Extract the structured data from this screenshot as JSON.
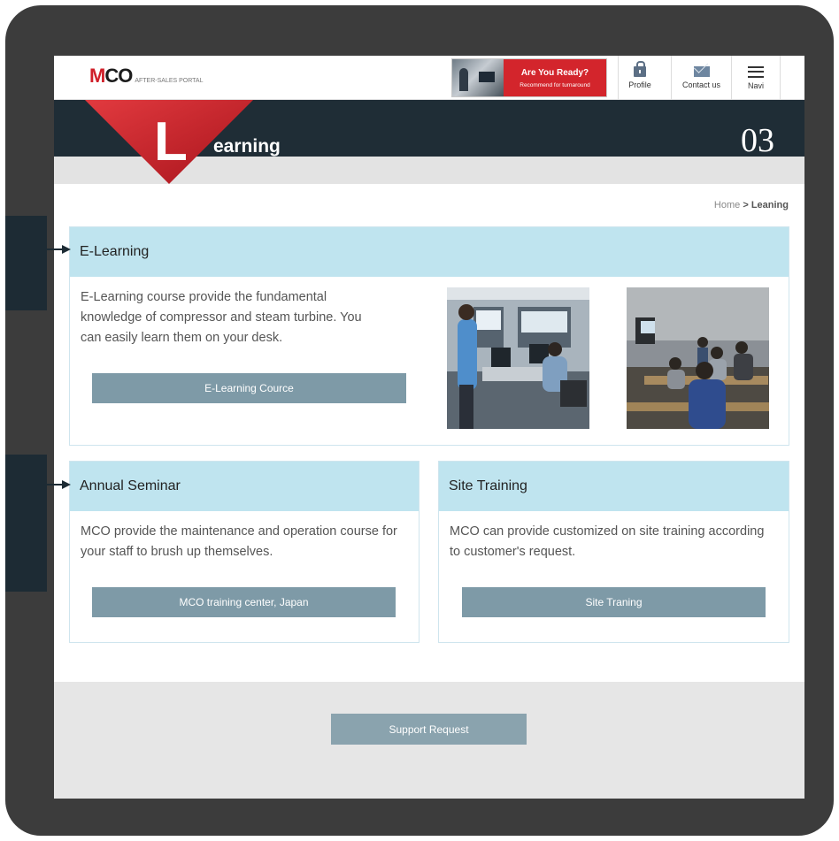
{
  "header": {
    "logo_mark_m": "M",
    "logo_mark_co": "CO",
    "logo_subtitle": "AFTER-SALES PORTAL",
    "banner_title": "Are You Ready?",
    "banner_subtitle": "Recommend for turnaround",
    "nav": [
      {
        "label": "Profile",
        "icon": "lock-icon"
      },
      {
        "label": "Contact us",
        "icon": "mail-icon"
      },
      {
        "label": "Navi",
        "icon": "menu-icon"
      }
    ]
  },
  "hero": {
    "letter": "L",
    "title": "earning",
    "number": "03",
    "colors": {
      "band": "#1f2d36",
      "accent": "#d0202a"
    }
  },
  "breadcrumb": {
    "home": "Home",
    "separator": ">",
    "current": "Leaning"
  },
  "sections": {
    "elearning": {
      "title": "E-Learning",
      "description": "E-Learning course provide the fundamental knowledge of compressor and steam turbine. You can easily learn them on your desk.",
      "button": "E-Learning Cource"
    },
    "annual_seminar": {
      "title": "Annual Seminar",
      "description": "MCO provide the maintenance and operation course for your staff to brush up themselves.",
      "button": "MCO training center, Japan"
    },
    "site_training": {
      "title": "Site Training",
      "description": "MCO can provide customized on site training according to customer's request.",
      "button": "Site Traning"
    }
  },
  "footer": {
    "support_button": "Support Request"
  }
}
